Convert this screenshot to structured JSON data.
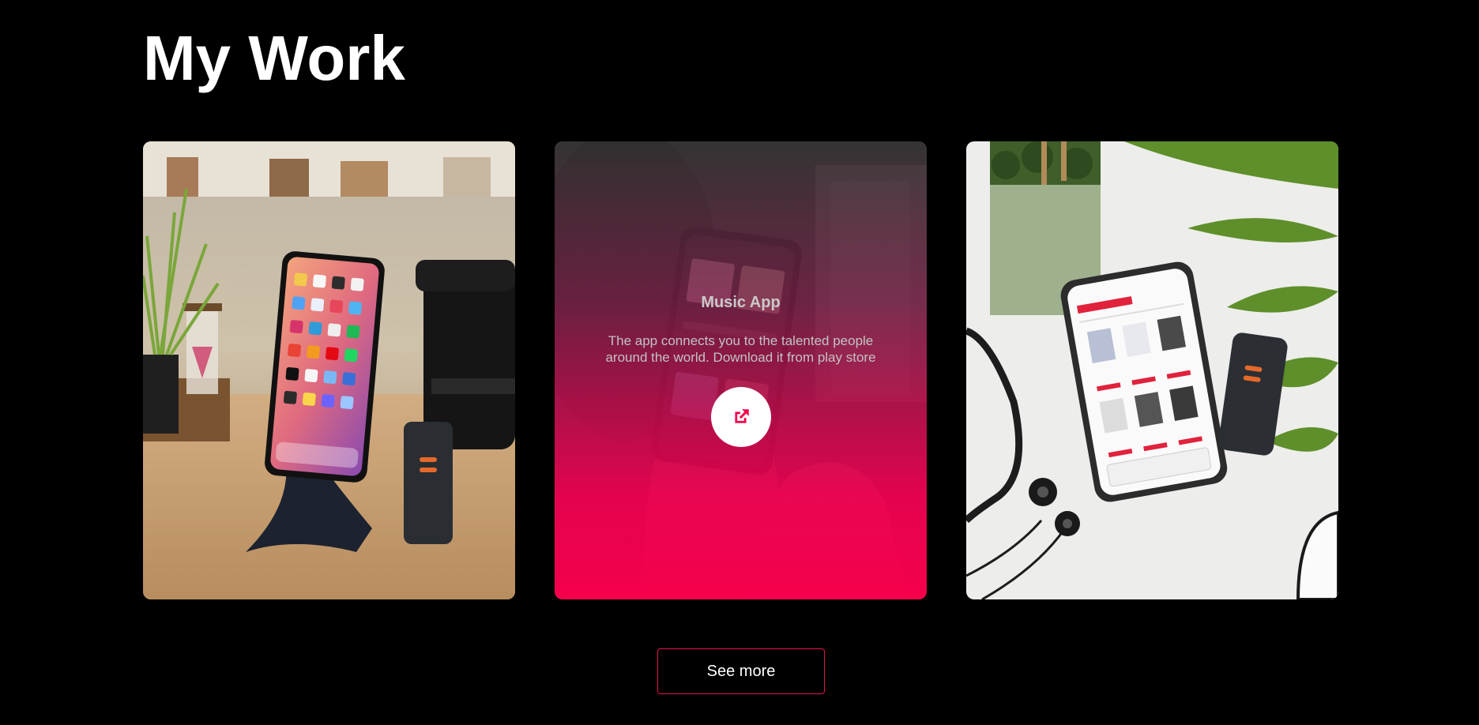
{
  "section": {
    "title": "My Work"
  },
  "projects": [
    {
      "image_alt": "phone-on-stand-photo"
    },
    {
      "title": "Music App",
      "description": "The app connects you to the talented people around the world. Download it from play store",
      "link_icon": "external-link-icon",
      "image_alt": "music-app-phone-photo"
    },
    {
      "image_alt": "us-store-phone-photo"
    }
  ],
  "see_more_label": "See more",
  "colors": {
    "background": "#000000",
    "accent": "#f5004b",
    "text": "#ffffff"
  }
}
